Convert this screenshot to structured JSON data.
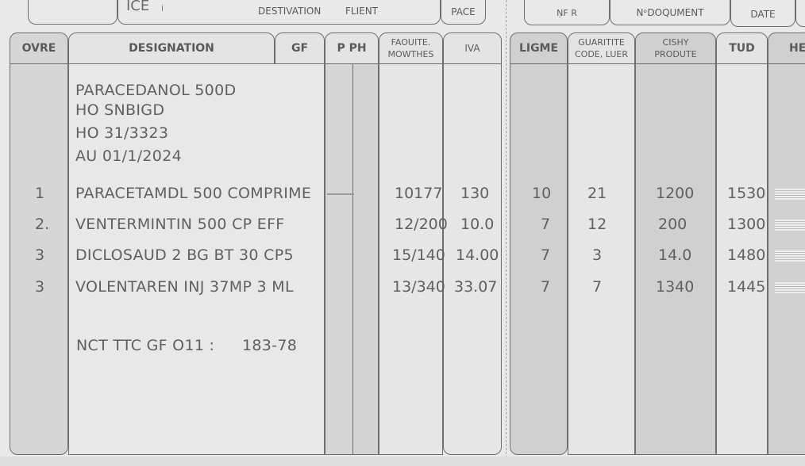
{
  "top": {
    "ice_label": "ICE",
    "ice_mark": "i",
    "destination_label": "DESTIVATION",
    "client_label": "FLIENT",
    "page_label": "PACE",
    "nf_label": "ṆF R",
    "document_label": "NᵒDOQUMENT",
    "date_label": "DATE"
  },
  "left_headers": {
    "ovre": "OVRE",
    "designation": "DESIGNATION",
    "gf": "GF",
    "pph": "P PH",
    "faouite_line1": "FAOUITE.",
    "faouite_line2": "MOWTHES",
    "iva": "IVA"
  },
  "right_headers": {
    "ligme": "LIGME",
    "quantity_line1": "GUARITITE",
    "quantity_line2": "CODE, LUER",
    "cishy_line1": "CISHY",
    "cishy_line2": "PRODUTE",
    "tud": "TUD",
    "he": "HE"
  },
  "intro_lines": [
    "PARACEDANOL 500D",
    "HO SNBIGD",
    "HO 31/3323",
    "AU 01/1/2024"
  ],
  "rows": [
    {
      "no": "1",
      "designation": "PARACETAMDL 500 COMPRIME",
      "faouite": "10177",
      "iva": "130",
      "ligme": "10",
      "quantity": "21",
      "cishy": "1200",
      "tud": "1530"
    },
    {
      "no": "2.",
      "designation": "VENTERMINTIN 500 CP EFF",
      "faouite": "12/200",
      "iva": "10.0",
      "ligme": "7",
      "quantity": "12",
      "cishy": "200",
      "tud": "1300"
    },
    {
      "no": "3",
      "designation": "DICLOSAUD 2 BG BT 30 CP5",
      "faouite": "15/140",
      "iva": "14.00",
      "ligme": "7",
      "quantity": "3",
      "cishy": "14.0",
      "tud": "1480"
    },
    {
      "no": "3",
      "designation": "VOLENTAREN INJ 37MP 3  ML",
      "faouite": "13/340",
      "iva": "33.07",
      "ligme": "7",
      "quantity": "7",
      "cishy": "1340",
      "tud": "1445"
    }
  ],
  "footer": {
    "label": "NCT TTC GF O11 :",
    "value": "183-78"
  }
}
